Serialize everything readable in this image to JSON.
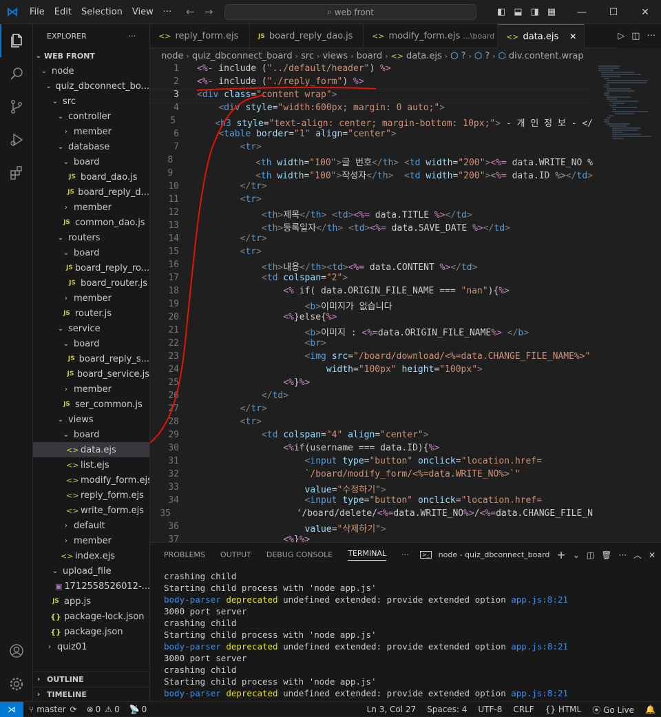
{
  "titlebar": {
    "menu": [
      "File",
      "Edit",
      "Selection",
      "View",
      "···"
    ],
    "search": "web front"
  },
  "explorer": {
    "header": "EXPLORER",
    "more": "···",
    "root": "WEB FRONT",
    "tree": [
      {
        "label": "node",
        "depth": 0,
        "kind": "folder",
        "open": true
      },
      {
        "label": "quiz_dbconnect_bo...",
        "depth": 1,
        "kind": "folder",
        "open": true
      },
      {
        "label": "src",
        "depth": 2,
        "kind": "folder",
        "open": true
      },
      {
        "label": "controller",
        "depth": 3,
        "kind": "folder",
        "open": true
      },
      {
        "label": "member",
        "depth": 4,
        "kind": "folder",
        "open": false
      },
      {
        "label": "database",
        "depth": 3,
        "kind": "folder",
        "open": true
      },
      {
        "label": "board",
        "depth": 4,
        "kind": "folder",
        "open": true
      },
      {
        "label": "board_dao.js",
        "depth": 5,
        "kind": "js"
      },
      {
        "label": "board_reply_d...",
        "depth": 5,
        "kind": "js"
      },
      {
        "label": "member",
        "depth": 4,
        "kind": "folder",
        "open": false
      },
      {
        "label": "common_dao.js",
        "depth": 4,
        "kind": "js"
      },
      {
        "label": "routers",
        "depth": 3,
        "kind": "folder",
        "open": true
      },
      {
        "label": "board",
        "depth": 4,
        "kind": "folder",
        "open": true
      },
      {
        "label": "board_reply_ro...",
        "depth": 5,
        "kind": "js"
      },
      {
        "label": "board_router.js",
        "depth": 5,
        "kind": "js"
      },
      {
        "label": "member",
        "depth": 4,
        "kind": "folder",
        "open": false
      },
      {
        "label": "router.js",
        "depth": 4,
        "kind": "js"
      },
      {
        "label": "service",
        "depth": 3,
        "kind": "folder",
        "open": true
      },
      {
        "label": "board",
        "depth": 4,
        "kind": "folder",
        "open": true
      },
      {
        "label": "board_reply_s...",
        "depth": 5,
        "kind": "js"
      },
      {
        "label": "board_service.js",
        "depth": 5,
        "kind": "js"
      },
      {
        "label": "member",
        "depth": 4,
        "kind": "folder",
        "open": false
      },
      {
        "label": "ser_common.js",
        "depth": 4,
        "kind": "js"
      },
      {
        "label": "views",
        "depth": 3,
        "kind": "folder",
        "open": true
      },
      {
        "label": "board",
        "depth": 4,
        "kind": "folder",
        "open": true
      },
      {
        "label": "data.ejs",
        "depth": 5,
        "kind": "ejs",
        "selected": true
      },
      {
        "label": "list.ejs",
        "depth": 5,
        "kind": "ejs"
      },
      {
        "label": "modify_form.ejs",
        "depth": 5,
        "kind": "ejs"
      },
      {
        "label": "reply_form.ejs",
        "depth": 5,
        "kind": "ejs"
      },
      {
        "label": "write_form.ejs",
        "depth": 5,
        "kind": "ejs"
      },
      {
        "label": "default",
        "depth": 4,
        "kind": "folder",
        "open": false
      },
      {
        "label": "member",
        "depth": 4,
        "kind": "folder",
        "open": false
      },
      {
        "label": "index.ejs",
        "depth": 4,
        "kind": "ejs"
      },
      {
        "label": "upload_file",
        "depth": 2,
        "kind": "folder",
        "open": true
      },
      {
        "label": "1712558526012-...",
        "depth": 3,
        "kind": "img"
      },
      {
        "label": "app.js",
        "depth": 2,
        "kind": "js"
      },
      {
        "label": "package-lock.json",
        "depth": 2,
        "kind": "json"
      },
      {
        "label": "package.json",
        "depth": 2,
        "kind": "json"
      },
      {
        "label": "quiz01",
        "depth": 1,
        "kind": "folder",
        "open": false
      }
    ],
    "outline": "OUTLINE",
    "timeline": "TIMELINE"
  },
  "tabs": [
    {
      "label": "reply_form.ejs",
      "desc": "",
      "active": false
    },
    {
      "label": "board_reply_dao.js",
      "desc": "",
      "active": false,
      "js": true
    },
    {
      "label": "modify_form.ejs",
      "desc": "...\\board",
      "active": false
    },
    {
      "label": "data.ejs",
      "desc": "",
      "active": true,
      "close": "✕"
    }
  ],
  "breadcrumbs": [
    "node",
    "quiz_dbconnect_board",
    "src",
    "views",
    "board",
    "data.ejs",
    "?",
    "?",
    "div.content.wrap"
  ],
  "code": [
    "<%- include (\"../default/header\") %>",
    "<%- include (\"./reply_form\") %>",
    "<div class=\"content wrap\">",
    "    <div style=\"width:600px; margin: 0 auto;\">",
    "    <h3 style=\"text-align: center; margin-bottom: 10px;\"> - 개 인 정 보 - </",
    "    <table border=\"1\" align=\"center\">",
    "        <tr>",
    "            <th width=\"100\">글 번호</th> <td width=\"200\"><%= data.WRITE_NO %",
    "            <th width=\"100\">작성자</th>  <td width=\"200\"><%= data.ID %></td>",
    "        </tr>",
    "        <tr>",
    "            <th>제목</th> <td><%= data.TITLE %></td>",
    "            <th>등록일자</th> <td><%= data.SAVE_DATE %></td>",
    "        </tr>",
    "        <tr>",
    "            <th>내용</th><td><%= data.CONTENT %></td>",
    "            <td colspan=\"2\">",
    "                <% if( data.ORIGIN_FILE_NAME === \"nan\"){%>",
    "                    <b>이미지가 없습니다",
    "                <%}else{%>",
    "                    <b>이미지 : <%=data.ORIGIN_FILE_NAME%> </b>",
    "                    <br>",
    "                    <img src=\"/board/download/<%=data.CHANGE_FILE_NAME%>\"",
    "                        width=\"100px\" height=\"100px\">",
    "                <%}%>",
    "            </td>",
    "        </tr>",
    "        <tr>",
    "            <td colspan=\"4\" align=\"center\">",
    "                <%if(username === data.ID){%>",
    "                    <input type=\"button\" onclick=\"location.href=",
    "                    `/board/modify_form/<%=data.WRITE_NO%>`\"",
    "                    value=\"수정하기\">",
    "                    <input type=\"button\" onclick=\"location.href=",
    "                    '/board/delete/<%=data.WRITE_NO%>/<%=data.CHANGE_FILE_N",
    "                    value=\"삭제하기\">",
    "                <%}%>"
  ],
  "line_numbers": [
    "1",
    "2",
    "3",
    "4",
    "5",
    "6",
    "7",
    "8",
    "9",
    "10",
    "11",
    "12",
    "13",
    "14",
    "15",
    "16",
    "17",
    "18",
    "19",
    "20",
    "21",
    "22",
    "23",
    "24",
    "25",
    "26",
    "27",
    "28",
    "29",
    "30",
    "31",
    "32",
    "33",
    "34",
    "35",
    "36",
    "37"
  ],
  "panel": {
    "tabs": [
      "PROBLEMS",
      "OUTPUT",
      "DEBUG CONSOLE",
      "TERMINAL",
      "···"
    ],
    "terminal_name": "node - quiz_dbconnect_board",
    "lines": [
      {
        "t": "crashing child",
        "k": "plain"
      },
      {
        "t": "Starting child process with 'node app.js'",
        "k": "plain"
      },
      {
        "a": "body-parser",
        "b": "deprecated",
        "c": " undefined extended: provide extended option ",
        "d": "app.js:8:21",
        "k": "dep"
      },
      {
        "t": "3000 port server",
        "k": "plain"
      },
      {
        "t": "crashing child",
        "k": "plain"
      },
      {
        "t": "Starting child process with 'node app.js'",
        "k": "plain"
      },
      {
        "a": "body-parser",
        "b": "deprecated",
        "c": " undefined extended: provide extended option ",
        "d": "app.js:8:21",
        "k": "dep"
      },
      {
        "t": "3000 port server",
        "k": "plain"
      },
      {
        "t": "crashing child",
        "k": "plain"
      },
      {
        "t": "Starting child process with 'node app.js'",
        "k": "plain"
      },
      {
        "a": "body-parser",
        "b": "deprecated",
        "c": " undefined extended: provide extended option ",
        "d": "app.js:8:21",
        "k": "dep"
      }
    ]
  },
  "status": {
    "branch": "master",
    "errors": "0",
    "warnings": "0",
    "ports": "0",
    "position": "Ln 3, Col 27",
    "spaces": "Spaces: 4",
    "encoding": "UTF-8",
    "eol": "CRLF",
    "language": "HTML",
    "golive": "Go Live"
  },
  "colors": {
    "accent": "#0078d4",
    "annotation": "#e51400"
  }
}
